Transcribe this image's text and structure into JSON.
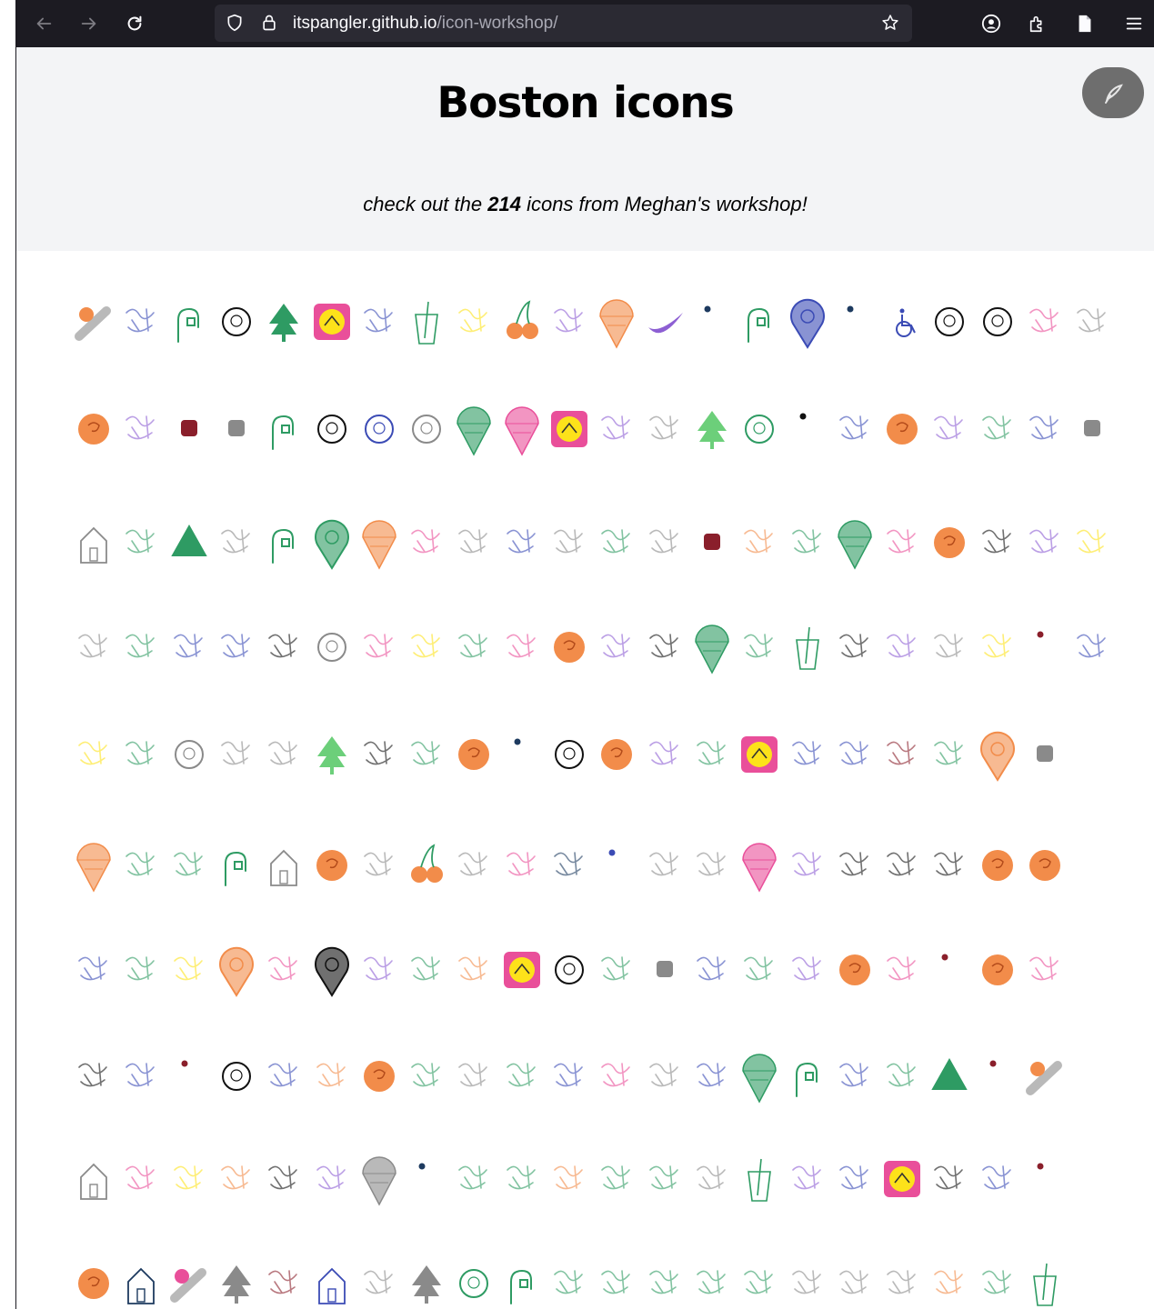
{
  "browser": {
    "url_domain": "itspangler.github.io",
    "url_path": "/icon-workshop/",
    "icons": [
      "back-arrow-icon",
      "forward-arrow-icon",
      "reload-icon",
      "shield-icon",
      "lock-icon",
      "star-icon",
      "account-icon",
      "extensions-icon",
      "page-icon",
      "menu-icon"
    ]
  },
  "page": {
    "title": "Boston icons",
    "tagline_before": "check out the ",
    "icon_count": "214",
    "tagline_after": " icons from Meghan's workshop!",
    "fab_icon": "feather-quill-icon"
  },
  "grid": {
    "description_colors": {
      "green": "#2e9b63",
      "orange": "#f28c4a",
      "blue": "#3b4bb5",
      "pink": "#e94f9a",
      "yellow": "#fde21a",
      "gray": "#8a8a8a",
      "maroon": "#8a1f2b",
      "navy": "#1d3a5f",
      "black": "#111111",
      "lightgreen": "#6ccf7a",
      "purple": "#8d5fd3"
    },
    "rows": [
      [
        "orange-diag",
        "blue-sketch",
        "green-hook",
        "black-ring",
        "green-tree",
        "yellow-magenta",
        "blue-sketch",
        "green-cup",
        "yellow-sketch",
        "orange-cherries",
        "purple-sketch",
        "orange-cone",
        "purple-swoosh",
        "navy-dot",
        "green-hook",
        "blue-pin",
        "navy-dot",
        "blue-wheel",
        "black-ring",
        "black-ring",
        "pink-sketch",
        "gray-sketch"
      ],
      [
        "orange-circle",
        "purple-sketch",
        "maroon-square",
        "gray-square",
        "green-hook",
        "black-ring",
        "blue-ring",
        "gray-ring",
        "green-cone",
        "pink-cone",
        "yellow-magenta",
        "purple-sketch",
        "gray-sketch",
        "lightgreen-tree",
        "green-ring",
        "black-dot",
        "blue-sketch",
        "orange-circle",
        "purple-sketch",
        "green-sketch",
        "blue-sketch",
        "gray-square"
      ],
      [
        "gray-house",
        "green-sketch",
        "green-triangle",
        "gray-sketch",
        "green-hook",
        "green-pin",
        "orange-cone",
        "pink-sketch",
        "gray-sketch",
        "blue-sketch",
        "gray-sketch",
        "green-sketch",
        "gray-sketch",
        "maroon-square",
        "orange-sketch",
        "green-sketch",
        "green-cone",
        "pink-sketch",
        "orange-circle",
        "black-sketch",
        "purple-sketch",
        "yellow-sketch"
      ],
      [
        "gray-sketch",
        "green-sketch",
        "blue-sketch",
        "blue-sketch",
        "black-sketch",
        "gray-ring",
        "pink-sketch",
        "yellow-sketch",
        "green-sketch",
        "pink-sketch",
        "orange-circle",
        "purple-sketch",
        "black-sketch",
        "green-cone",
        "green-sketch",
        "green-cup",
        "black-sketch",
        "purple-sketch",
        "gray-sketch",
        "yellow-sketch",
        "maroon-dot",
        "blue-sketch"
      ],
      [
        "yellow-sketch",
        "green-sketch",
        "gray-ring",
        "gray-sketch",
        "gray-sketch",
        "lightgreen-tree",
        "black-sketch",
        "green-sketch",
        "orange-circle",
        "navy-dot",
        "black-ring",
        "orange-circle",
        "purple-sketch",
        "green-sketch",
        "yellow-magenta",
        "blue-sketch",
        "blue-sketch",
        "maroon-sketch",
        "green-sketch",
        "orange-pin",
        "gray-square"
      ],
      [
        "orange-cone",
        "green-sketch",
        "green-sketch",
        "green-hook",
        "gray-house",
        "orange-circle",
        "gray-sketch",
        "orange-cherries",
        "gray-sketch",
        "pink-sketch",
        "navy-sketch",
        "blue-dot",
        "gray-sketch",
        "gray-sketch",
        "pink-cone",
        "purple-sketch",
        "black-sketch",
        "black-sketch",
        "black-sketch",
        "orange-circle",
        "orange-circle"
      ],
      [
        "blue-sketch",
        "green-sketch",
        "yellow-sketch",
        "orange-pin",
        "pink-sketch",
        "black-pin",
        "purple-sketch",
        "green-sketch",
        "orange-sketch",
        "yellow-magenta",
        "black-ring",
        "green-sketch",
        "gray-square",
        "blue-sketch",
        "green-sketch",
        "purple-sketch",
        "orange-circle",
        "pink-sketch",
        "maroon-dot",
        "orange-circle",
        "pink-sketch"
      ],
      [
        "black-sketch",
        "blue-sketch",
        "maroon-dot",
        "black-ring",
        "blue-sketch",
        "orange-sketch",
        "orange-circle",
        "green-sketch",
        "gray-sketch",
        "green-sketch",
        "blue-sketch",
        "pink-sketch",
        "gray-sketch",
        "blue-sketch",
        "green-cone",
        "green-hook",
        "blue-sketch",
        "green-sketch",
        "green-triangle",
        "maroon-dot",
        "orange-diag"
      ],
      [
        "gray-house",
        "pink-sketch",
        "yellow-sketch",
        "orange-sketch",
        "black-sketch",
        "purple-sketch",
        "gray-cone",
        "navy-dot",
        "green-sketch",
        "green-sketch",
        "orange-sketch",
        "green-sketch",
        "green-sketch",
        "gray-sketch",
        "green-cup",
        "purple-sketch",
        "blue-sketch",
        "yellow-magenta",
        "black-sketch",
        "blue-sketch",
        "maroon-dot"
      ],
      [
        "orange-circle",
        "navy-house",
        "pink-diag",
        "gray-tree",
        "maroon-sketch",
        "blue-house",
        "gray-sketch",
        "gray-tree",
        "green-ring",
        "green-hook",
        "green-sketch",
        "green-sketch",
        "green-sketch",
        "green-sketch",
        "green-sketch",
        "gray-sketch",
        "gray-sketch",
        "gray-sketch",
        "orange-sketch",
        "green-sketch",
        "green-cup"
      ]
    ]
  }
}
